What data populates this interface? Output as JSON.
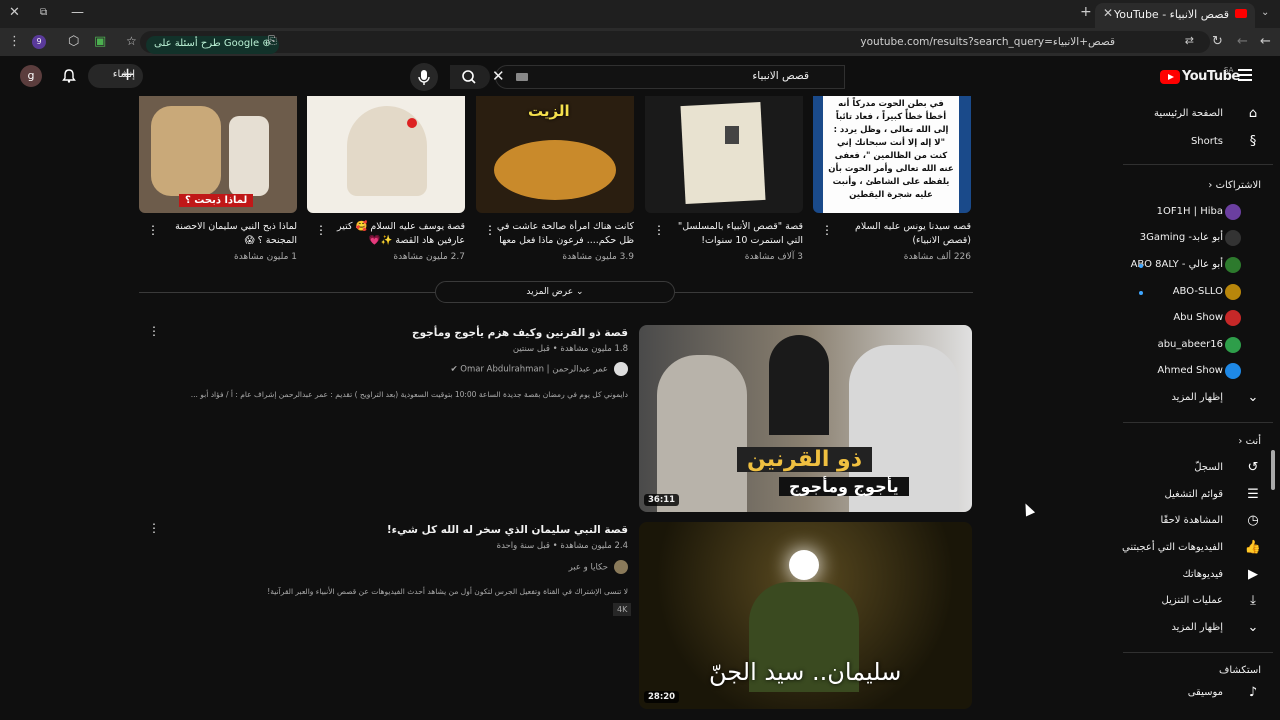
{
  "browser": {
    "tab_title": "قصص الانبياء - YouTube",
    "url": "youtube.com/results?search_query=قصص+الانبياء",
    "ask_pill": "طرح أسئلة على Google",
    "ext_badge": "9"
  },
  "header": {
    "logo": "YouTube",
    "region": "SA",
    "search_query": "قصص الانبياء",
    "create_label": "إنشاء",
    "avatar_letter": "g"
  },
  "sidebar": {
    "home": "الصفحة الرئيسية",
    "shorts": "Shorts",
    "subscriptions_header": "الاشتراكات",
    "subs": [
      {
        "name": "1OF1H | Hiba",
        "color": "#6b3fa0"
      },
      {
        "name": "أبو عابد- 3Gaming",
        "color": "#333333"
      },
      {
        "name": "أبو عالي - ABO 8ALY",
        "color": "#2d7a2d"
      },
      {
        "name": "ABO-SLLO",
        "color": "#b8860b"
      },
      {
        "name": "Abu Show",
        "color": "#c62828"
      },
      {
        "name": "abu_abeer16",
        "color": "#2e9e4a"
      },
      {
        "name": "Ahmed Show",
        "color": "#1e88e5"
      }
    ],
    "show_more": "إظهار المزيد",
    "you_header": "أنت",
    "you_items": [
      "السجلّ",
      "قوائم التشغيل",
      "المشاهدة لاحقًا",
      "الفيديوهات التي أعجبتني",
      "فيديوهاتك",
      "عمليات التنزيل"
    ],
    "show_more2": "إظهار المزيد",
    "explore_header": "استكشاف",
    "explore_items": [
      "موسيقى"
    ]
  },
  "top_videos": [
    {
      "title": "قصه سيدنا يونس عليه السلام (قصص الانبياء)",
      "meta": "226 ألف مشاهدة"
    },
    {
      "title": "قصة \"قصص الأنبياء بالمسلسل\" التي استمرت 10 سنوات!",
      "meta": "3 آلاف مشاهدة"
    },
    {
      "title": "كانت هناك امرأة صالحة عاشت في ظل حكم.... فرعون ماذا فعل معها ومع ...",
      "meta": "3.9 مليون مشاهدة"
    },
    {
      "title": "قصة يوسف عليه السلام 🥰 كتير عارفين هاد القصة ✨💗",
      "meta": "2.7 مليون مشاهدة"
    },
    {
      "title": "لماذا ذبح النبي سليمان الاحصنة المجنحة ؟ 😱",
      "meta": "1 مليون مشاهدة"
    }
  ],
  "thumb_text": {
    "yunus": "في بطن الحوت مدركاً أنه أخطأ خطأً كبيراً ، فعاد تائباً إلى الله تعالى ، وظل يردد : \"لا إله إلا أنت سبحانك إني كنت من الظالمين \"، فعفى عنه الله تعالى وأمر الحوت بأن يلفظه على الشاطئ ، وأنبت عليه شجرة اليقطين",
    "zayt": "الزيت",
    "horse": "لماذا ذبحت ؟",
    "dhul1": "ذو القرنين",
    "dhul2": "يأجوج ومأجوج",
    "suleiman": "سليمان.. سيد الجنّ"
  },
  "show_more_btn": "عرض المزيد",
  "results": [
    {
      "title": "قصة ذو القرنين وكيف هزم يأجوج ومأجوج",
      "meta": "1.8 مليون مشاهدة • قبل سنتين",
      "channel": "عمر عبدالرحمن | Omar Abdulrahman",
      "desc": "دايموني كل يوم في رمضان بقصة جديدة الساعة 10:00 بتوقيت السعودية (بعد التراويح ) تقديم : عمر عبدالرحمن إشراف عام : أ / فؤاد أبو ...",
      "duration": "36:11"
    },
    {
      "title": "قصة النبي سليمان الذي سخر له الله كل شيء!",
      "meta": "2.4 مليون مشاهدة • قبل سنة واحدة",
      "channel": "حكايا و عبر",
      "desc": "لا تنسى الإشتراك في القناة وتفعيل الجرس لتكون أول من يشاهد أحدث الفيديوهات عن قصص الأنبياء والعبر القرآنية!",
      "duration": "28:20",
      "badge": "4K"
    }
  ]
}
